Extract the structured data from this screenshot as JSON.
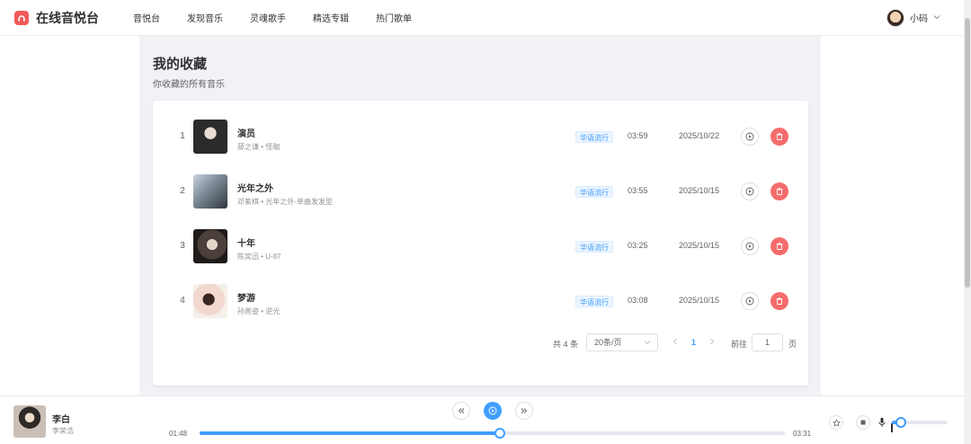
{
  "header": {
    "app_title": "在线音悦台",
    "nav": [
      "音悦台",
      "发现音乐",
      "灵魂歌手",
      "精选专辑",
      "热门歌单"
    ],
    "user_name": "小码"
  },
  "page": {
    "title": "我的收藏",
    "subtitle": "你收藏的所有音乐"
  },
  "songs": [
    {
      "index": "1",
      "title": "演员",
      "artist": "薛之谦",
      "album": "怪咖",
      "genre": "华语流行",
      "duration": "03:59",
      "date": "2025/10/22"
    },
    {
      "index": "2",
      "title": "光年之外",
      "artist": "邓紫棋",
      "album": "光年之外-单曲发发型",
      "genre": "华语流行",
      "duration": "03:55",
      "date": "2025/10/15"
    },
    {
      "index": "3",
      "title": "十年",
      "artist": "陈奕迅",
      "album": "U-87",
      "genre": "华语流行",
      "duration": "03:25",
      "date": "2025/10/15"
    },
    {
      "index": "4",
      "title": "梦游",
      "artist": "孙燕姿",
      "album": "逆光",
      "genre": "华语流行",
      "duration": "03:08",
      "date": "2025/10/15"
    }
  ],
  "meta_separator": "•",
  "pagination": {
    "total_text": "共 4 条",
    "page_size": "20条/页",
    "current_page": "1",
    "goto_label": "前往",
    "goto_value": "1",
    "page_unit": "页"
  },
  "player": {
    "title": "李白",
    "artist": "李荣浩",
    "current_time": "01:48",
    "total_time": "03:31",
    "progress": 0.513,
    "volume": 0.16
  },
  "colors": {
    "accent": "#409eff",
    "danger": "#f56c6c",
    "logo": "#ef5b5b"
  }
}
